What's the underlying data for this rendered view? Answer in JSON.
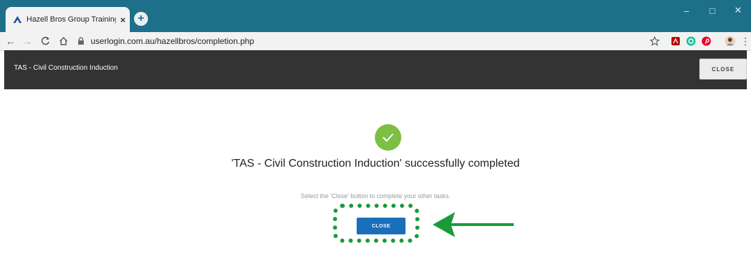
{
  "browser": {
    "tab_title": "Hazell Bros Group Training Platfo",
    "tab_close": "×",
    "new_tab": "+",
    "url": "userlogin.com.au/hazellbros/completion.php",
    "window_controls": {
      "minimize": "–",
      "maximize": "□",
      "close": "✕"
    }
  },
  "app": {
    "title": "TAS - Civil Construction Induction",
    "header_close_label": "CLOSE"
  },
  "content": {
    "completed_message": "'TAS - Civil Construction Induction' successfully completed",
    "instruction": "Select the 'Close' button to complete your other tasks.",
    "close_button_label": "CLOSE"
  },
  "colors": {
    "titlebar": "#1d6f8a",
    "app_header": "#333333",
    "success": "#7cbf44",
    "primary_button": "#1a6fba",
    "annotation": "#1a9a3a"
  }
}
